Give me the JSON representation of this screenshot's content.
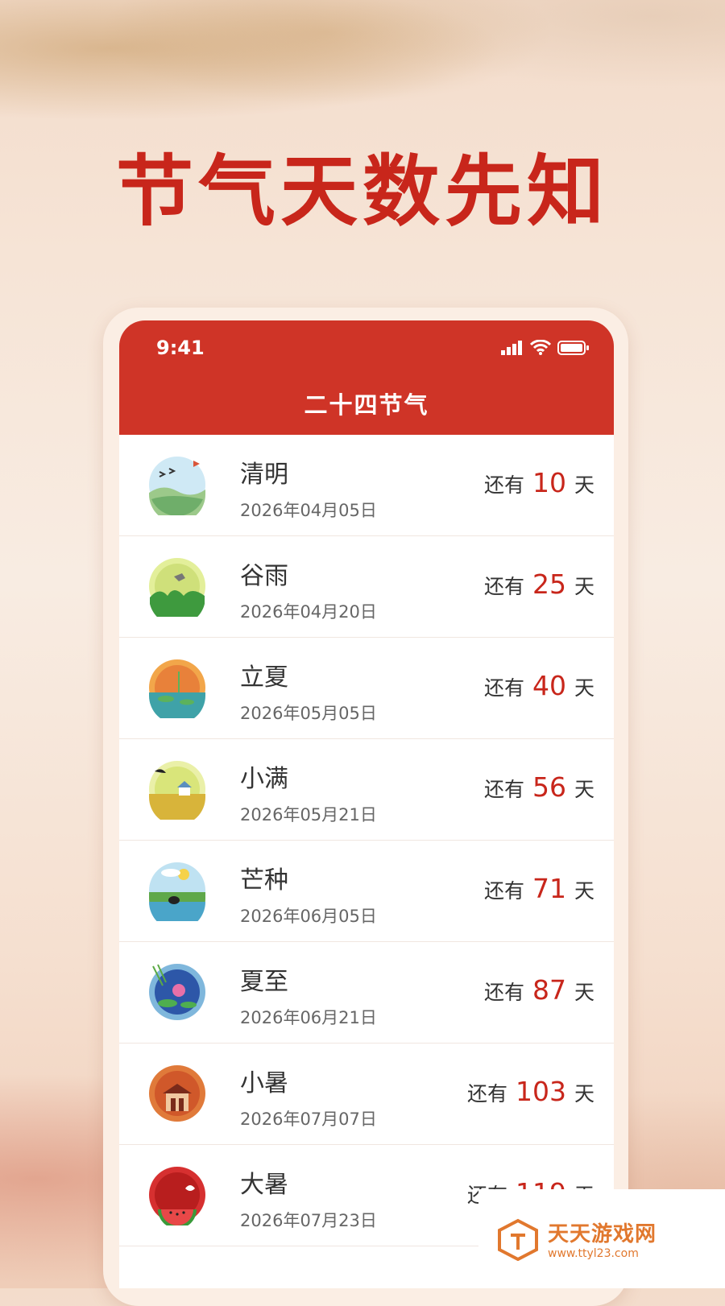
{
  "promo": {
    "headline": "节气天数先知"
  },
  "status_bar": {
    "time": "9:41"
  },
  "app": {
    "title": "二十四节气"
  },
  "terms": [
    {
      "name": "清明",
      "date": "2026年04月05日",
      "prefix": "还有",
      "days": "10",
      "suffix": "天"
    },
    {
      "name": "谷雨",
      "date": "2026年04月20日",
      "prefix": "还有",
      "days": "25",
      "suffix": "天"
    },
    {
      "name": "立夏",
      "date": "2026年05月05日",
      "prefix": "还有",
      "days": "40",
      "suffix": "天"
    },
    {
      "name": "小满",
      "date": "2026年05月21日",
      "prefix": "还有",
      "days": "56",
      "suffix": "天"
    },
    {
      "name": "芒种",
      "date": "2026年06月05日",
      "prefix": "还有",
      "days": "71",
      "suffix": "天"
    },
    {
      "name": "夏至",
      "date": "2026年06月21日",
      "prefix": "还有",
      "days": "87",
      "suffix": "天"
    },
    {
      "name": "小暑",
      "date": "2026年07月07日",
      "prefix": "还有",
      "days": "103",
      "suffix": "天"
    },
    {
      "name": "大暑",
      "date": "2026年07月23日",
      "prefix": "还有",
      "days": "119",
      "suffix": "天"
    }
  ],
  "watermark": {
    "title": "天天游戏网",
    "url": "www.ttyl23.com"
  },
  "colors": {
    "primary": "#cf3427",
    "accent_number": "#c8261b",
    "headline": "#c8261b",
    "watermark": "#e1782e"
  }
}
